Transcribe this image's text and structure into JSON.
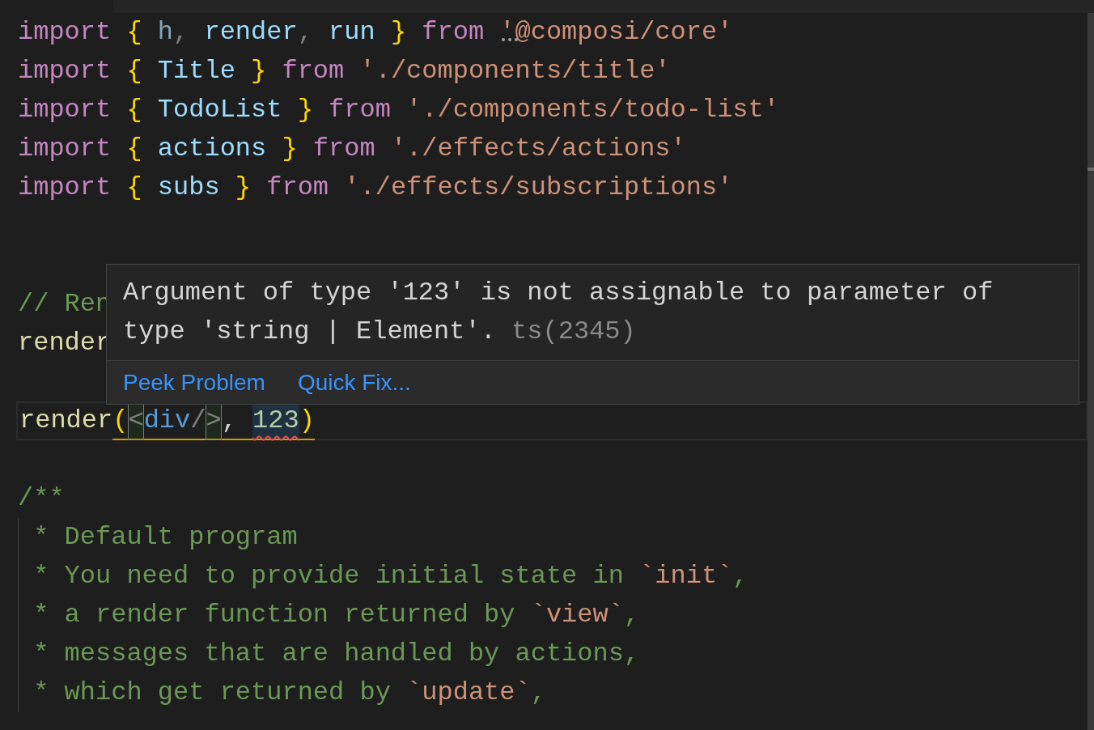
{
  "editor": {
    "lines": [
      {
        "tokens": [
          {
            "text": "import ",
            "kind": "keyword"
          },
          {
            "text": "{ ",
            "kind": "brace"
          },
          {
            "text": "h",
            "kind": "unused"
          },
          {
            "text": ", ",
            "kind": "punct"
          },
          {
            "text": "render",
            "kind": "variable"
          },
          {
            "text": ", ",
            "kind": "punct"
          },
          {
            "text": "run ",
            "kind": "variable"
          },
          {
            "text": "} ",
            "kind": "brace"
          },
          {
            "text": "from ",
            "kind": "keyword"
          },
          {
            "text": "'@composi/core'",
            "kind": "string",
            "hint": true
          }
        ]
      },
      {
        "tokens": [
          {
            "text": "import ",
            "kind": "keyword"
          },
          {
            "text": "{",
            "kind": "brace"
          },
          {
            "text": " Title ",
            "kind": "variable"
          },
          {
            "text": "} ",
            "kind": "brace"
          },
          {
            "text": "from ",
            "kind": "keyword"
          },
          {
            "text": "'./components/title'",
            "kind": "string"
          }
        ]
      },
      {
        "tokens": [
          {
            "text": "import ",
            "kind": "keyword"
          },
          {
            "text": "{",
            "kind": "brace"
          },
          {
            "text": " TodoList ",
            "kind": "variable"
          },
          {
            "text": "} ",
            "kind": "brace"
          },
          {
            "text": "from ",
            "kind": "keyword"
          },
          {
            "text": "'./components/todo-list'",
            "kind": "string"
          }
        ]
      },
      {
        "tokens": [
          {
            "text": "import ",
            "kind": "keyword"
          },
          {
            "text": "{",
            "kind": "brace"
          },
          {
            "text": " actions ",
            "kind": "variable"
          },
          {
            "text": "} ",
            "kind": "brace"
          },
          {
            "text": "from ",
            "kind": "keyword"
          },
          {
            "text": "'./effects/actions'",
            "kind": "string"
          }
        ]
      },
      {
        "tokens": [
          {
            "text": "import ",
            "kind": "keyword"
          },
          {
            "text": "{",
            "kind": "brace"
          },
          {
            "text": " subs ",
            "kind": "variable"
          },
          {
            "text": "} ",
            "kind": "brace"
          },
          {
            "text": "from ",
            "kind": "keyword"
          },
          {
            "text": "'./effects/subscriptions'",
            "kind": "string"
          }
        ]
      },
      {
        "kind": "blank"
      },
      {
        "kind": "blank"
      },
      {
        "tokens": [
          {
            "text": "// Ren",
            "kind": "comment"
          }
        ]
      },
      {
        "tokens": [
          {
            "text": "render",
            "kind": "function"
          }
        ]
      },
      {
        "kind": "blank"
      },
      {
        "current": true,
        "tokens": [
          {
            "text": "render",
            "kind": "function"
          },
          {
            "text": "(",
            "kind": "brace",
            "warning": true
          },
          {
            "text": "<",
            "kind": "punct",
            "warning": true,
            "matched": true
          },
          {
            "text": "div",
            "kind": "tag",
            "warning": true
          },
          {
            "text": "/",
            "kind": "punct",
            "warning": true
          },
          {
            "text": ">",
            "kind": "punct",
            "warning": true,
            "matched": true
          },
          {
            "text": ", ",
            "kind": "plain",
            "warning": true
          },
          {
            "text": "123",
            "kind": "number",
            "warning": true,
            "error": true,
            "highlight": true
          },
          {
            "text": ")",
            "kind": "brace",
            "warning": true
          }
        ]
      },
      {
        "kind": "blank"
      },
      {
        "tokens": [
          {
            "text": "/**",
            "kind": "comment"
          }
        ]
      },
      {
        "indent_guide": true,
        "tokens": [
          {
            "text": "* Default program",
            "kind": "comment"
          }
        ]
      },
      {
        "indent_guide": true,
        "tokens": [
          {
            "text": "* You need to provide initial state in ",
            "kind": "comment"
          },
          {
            "text": "`init`",
            "kind": "comment_code"
          },
          {
            "text": ",",
            "kind": "comment"
          }
        ]
      },
      {
        "indent_guide": true,
        "tokens": [
          {
            "text": "* a render function returned by ",
            "kind": "comment"
          },
          {
            "text": "`view`",
            "kind": "comment_code"
          },
          {
            "text": ",",
            "kind": "comment"
          }
        ]
      },
      {
        "indent_guide": true,
        "tokens": [
          {
            "text": "* messages that are handled by actions,",
            "kind": "comment"
          }
        ]
      },
      {
        "indent_guide": true,
        "tokens": [
          {
            "text": "* which get returned by ",
            "kind": "comment"
          },
          {
            "text": "`update`",
            "kind": "comment_code"
          },
          {
            "text": ",",
            "kind": "comment"
          }
        ]
      }
    ]
  },
  "hover": {
    "message": "Argument of type '123' is not assignable to parameter of type 'string | Element'.",
    "code": "ts(2345)",
    "actions": [
      "Peek Problem",
      "Quick Fix..."
    ]
  }
}
